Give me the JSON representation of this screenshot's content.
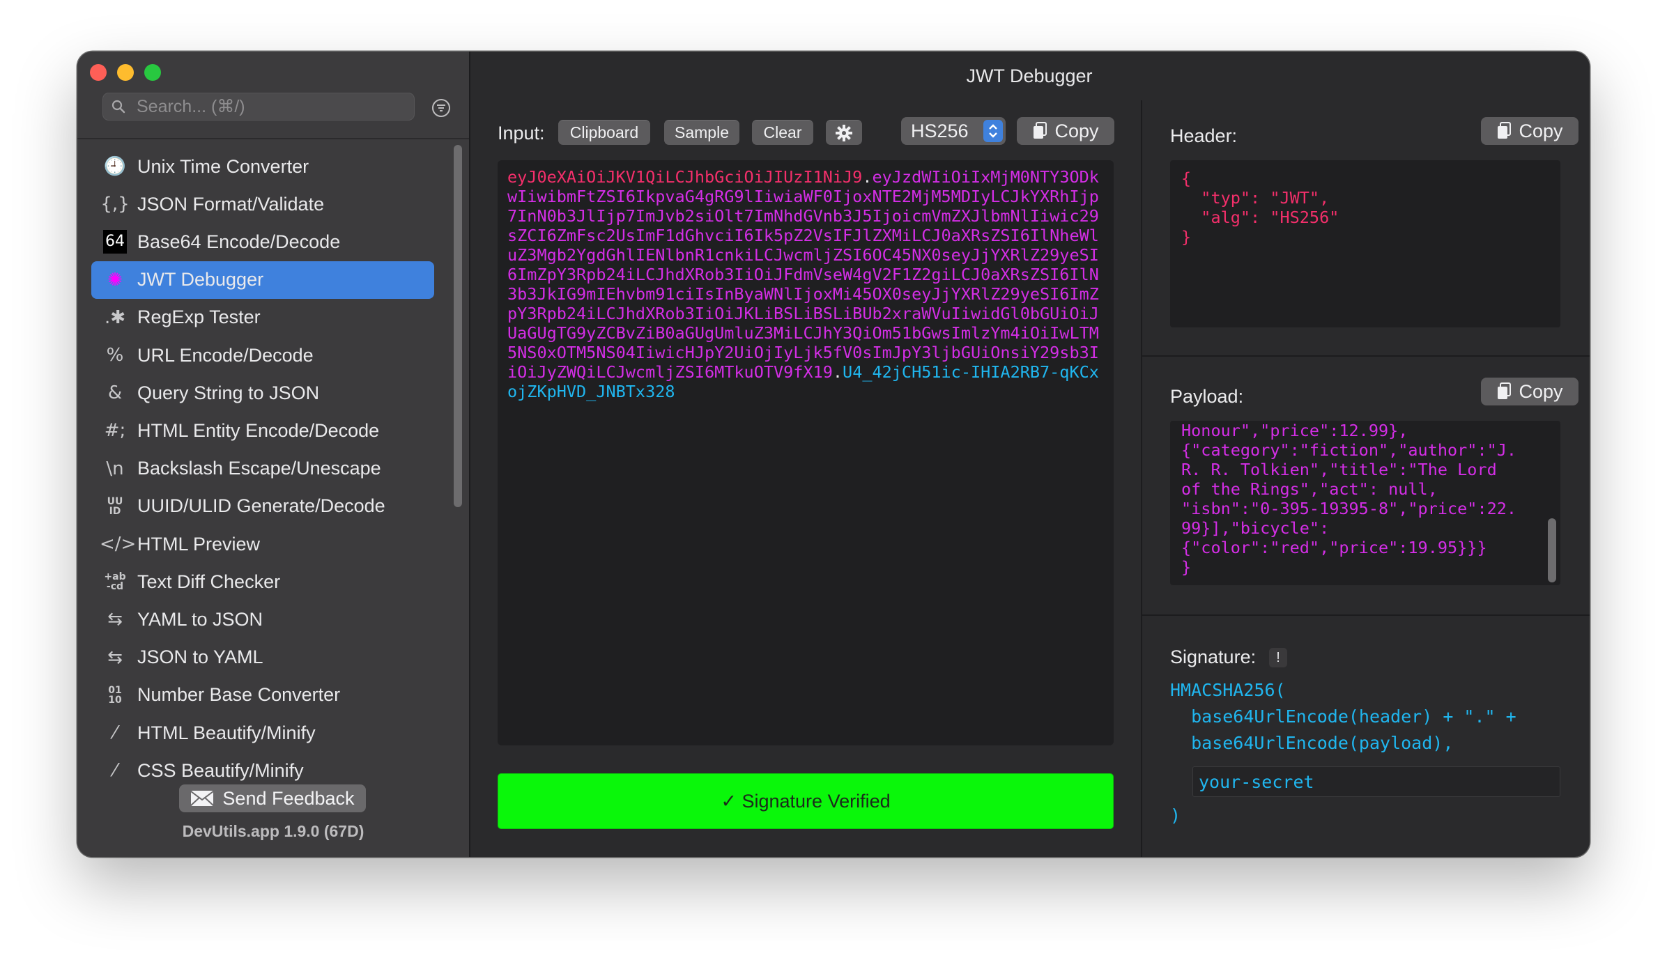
{
  "window": {
    "title": "JWT Debugger"
  },
  "sidebar": {
    "search_placeholder": "Search... (⌘/)",
    "items": [
      {
        "icon": "clock-icon",
        "glyph": "🕘",
        "label": "Unix Time Converter"
      },
      {
        "icon": "braces-icon",
        "glyph": "{,}",
        "label": "JSON Format/Validate"
      },
      {
        "icon": "base64-icon",
        "glyph": "64",
        "label": "Base64 Encode/Decode"
      },
      {
        "icon": "jwt-icon",
        "glyph": "✺",
        "label": "JWT Debugger"
      },
      {
        "icon": "regex-icon",
        "glyph": ".✱",
        "label": "RegExp Tester"
      },
      {
        "icon": "percent-icon",
        "glyph": "%",
        "label": "URL Encode/Decode"
      },
      {
        "icon": "ampersand-icon",
        "glyph": "&",
        "label": "Query String to JSON"
      },
      {
        "icon": "hash-icon",
        "glyph": "#;",
        "label": "HTML Entity Encode/Decode"
      },
      {
        "icon": "backslash-n-icon",
        "glyph": "\\n",
        "label": "Backslash Escape/Unescape"
      },
      {
        "icon": "uuid-icon",
        "glyph": "UU\nID",
        "label": "UUID/ULID Generate/Decode"
      },
      {
        "icon": "code-icon",
        "glyph": "</>",
        "label": "HTML Preview"
      },
      {
        "icon": "diff-icon",
        "glyph": "+ab\n-cd",
        "label": "Text Diff Checker"
      },
      {
        "icon": "arrows-swap-icon",
        "glyph": "⇆",
        "label": "YAML to JSON"
      },
      {
        "icon": "arrows-swap-icon",
        "glyph": "⇆",
        "label": "JSON to YAML"
      },
      {
        "icon": "binary-icon",
        "glyph": "01\n10",
        "label": "Number Base Converter"
      },
      {
        "icon": "magic-wand-icon",
        "glyph": "⁄",
        "label": "HTML Beautify/Minify"
      },
      {
        "icon": "magic-wand-icon",
        "glyph": "⁄",
        "label": "CSS Beautify/Minify"
      }
    ],
    "active_index": 3,
    "feedback_label": "Send Feedback",
    "version": "DevUtils.app 1.9.0 (67D)"
  },
  "input": {
    "label": "Input:",
    "clipboard": "Clipboard",
    "sample": "Sample",
    "clear": "Clear",
    "algorithm": "HS256",
    "copy": "Copy",
    "token_header": "eyJ0eXAiOiJKV1QiLCJhbGciOiJIUzI1NiJ9",
    "token_dot1": ".",
    "token_payload": "eyJzdWIiOiIxMjM0NTY3ODkwIiwibmFtZSI6IkpvaG4gRG9lIiwiaWF0IjoxNTE2MjM5MDIyLCJkYXRhIjp7InN0b3JlIjp7ImJvb2siOlt7ImNhdGVnb3J5IjoicmVmZXJlbmNlIiwic29sZCI6ZmFsc2UsImF1dGhvciI6Ik5pZ2VsIFJlZXMiLCJ0aXRsZSI6IlNheWluZ3Mgb2YgdGhlIENlbnR1cnkiLCJwcmljZSI6OC45NX0seyJjYXRlZ29yeSI6ImZpY3Rpb24iLCJhdXRob3IiOiJFdmVseW4gV2F1Z2giLCJ0aXRsZSI6IlN3b3JkIG9mIEhvbm91ciIsInByaWNlIjoxMi45OX0seyJjYXRlZ29yeSI6ImZpY3Rpb24iLCJhdXRob3IiOiJKLiBSLiBSLiBUb2xraWVuIiwidGl0bGUiOiJUaGUgTG9yZCBvZiB0aGUgUmluZ3MiLCJhY3QiOm51bGwsImlzYm4iOiIwLTM5NS0xOTM5NS04IiwicHJpY2UiOjIyLjk5fV0sImJpY3ljbGUiOnsiY29sb3IiOiJyZWQiLCJwcmljZSI6MTkuOTV9fX19",
    "token_dot2": ".",
    "token_signature": "U4_42jCH51ic-IHIA2RB7-qKCxojZKpHVD_JNBTx328",
    "status": "✓ Signature Verified"
  },
  "header": {
    "label": "Header:",
    "copy": "Copy",
    "json": "{\n  \"typ\": \"JWT\",\n  \"alg\": \"HS256\"\n}"
  },
  "payload": {
    "label": "Payload:",
    "copy": "Copy",
    "json_visible": "Honour\",\"price\":12.99},\n{\"category\":\"fiction\",\"author\":\"J.\nR. R. Tolkien\",\"title\":\"The Lord\nof the Rings\",\"act\": null,\n\"isbn\":\"0-395-19395-8\",\"price\":22.\n99}],\"bicycle\":\n{\"color\":\"red\",\"price\":19.95}}}\n}"
  },
  "signature": {
    "label": "Signature:",
    "warning": "!",
    "line1": "HMACSHA256(",
    "line2": "  base64UrlEncode(header) + \".\" +",
    "line3": "  base64UrlEncode(payload),",
    "secret_value": "your-secret",
    "line_end": ")"
  },
  "colors": {
    "accent": "#3f81dd",
    "success": "#0af70a",
    "jwt_header": "#f42f6b",
    "jwt_payload": "#d42ee6",
    "jwt_signature": "#20b6ef"
  }
}
